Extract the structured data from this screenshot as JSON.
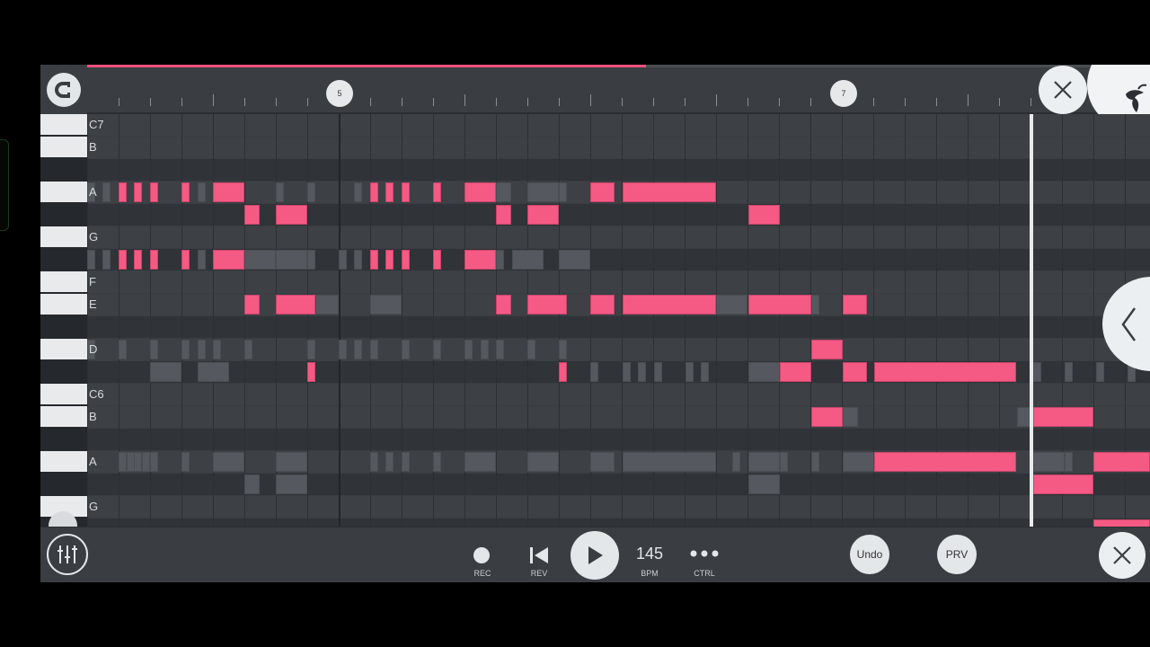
{
  "ruler": {
    "progress_percent": 52.6,
    "markers": [
      "5",
      "7"
    ]
  },
  "keyboard": {
    "labels": [
      "C7",
      "B",
      "A",
      "G",
      "F",
      "E",
      "D",
      "C6",
      "B",
      "A",
      "G"
    ]
  },
  "toolbar": {
    "rec_label": "REC",
    "rev_label": "REV",
    "tempo_value": "145",
    "bpm_label": "BPM",
    "ctrl_label": "CTRL",
    "undo_label": "Undo",
    "prv_label": "PRV"
  },
  "icons": {
    "snap": "magnet-icon",
    "close_top": "close-icon",
    "logo": "fl-studio-fruit-icon",
    "side": "chevron-left-icon",
    "mixer": "mixer-sliders-icon",
    "play": "play-icon",
    "rewind": "skip-back-icon",
    "record": "record-icon",
    "more": "more-dots-icon",
    "close_bottom": "close-icon"
  },
  "colors": {
    "note": "#f45a84",
    "progress": "#f0507c",
    "background": "#3a3e43"
  }
}
